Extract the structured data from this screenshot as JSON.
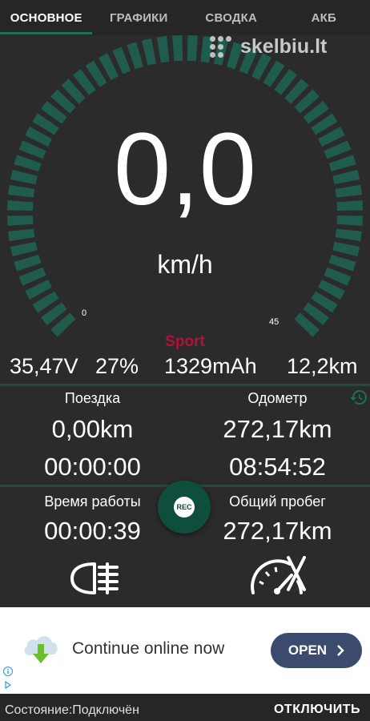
{
  "tabs": [
    {
      "label": "ОСНОВНОЕ",
      "active": true
    },
    {
      "label": "ГРАФИКИ",
      "active": false
    },
    {
      "label": "СВОДКА",
      "active": false
    },
    {
      "label": "АКБ",
      "active": false
    }
  ],
  "watermark": {
    "text": "skelbiu.lt"
  },
  "gauge": {
    "speed": "0,0",
    "unit": "km/h",
    "min_label": "0",
    "max_label": "45",
    "mode": "Sport",
    "value_fraction": 0,
    "accent_color": "#1e6e5a",
    "mode_color": "#b0123a"
  },
  "battery": {
    "voltage": "35,47V",
    "percent": "27%",
    "capacity": "1329mAh",
    "range": "12,2km"
  },
  "trip": {
    "label": "Поездка",
    "distance": "0,00km",
    "time": "00:00:00"
  },
  "odometer": {
    "label": "Одометр",
    "distance": "272,17km",
    "time": "08:54:52"
  },
  "uptime": {
    "label": "Время работы",
    "value": "00:00:39"
  },
  "total": {
    "label": "Общий пробег",
    "value": "272,17km"
  },
  "rec_button": {
    "label": "REC"
  },
  "icons": {
    "history": "history-icon",
    "headlight": "headlight-icon",
    "speedometer": "speedometer-off-icon"
  },
  "ad": {
    "text": "Continue online now",
    "button": "OPEN"
  },
  "status": {
    "text": "Состояние:Подключён",
    "action": "ОТКЛЮЧИТЬ"
  }
}
